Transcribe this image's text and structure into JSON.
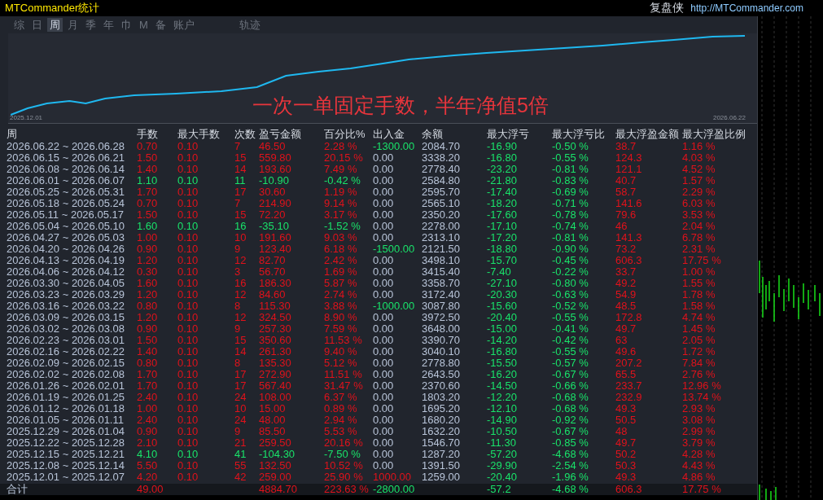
{
  "window": {
    "title": "MTCommander统计",
    "brand": "复盘侠",
    "url": "http://MTCommander.com"
  },
  "tabs": [
    {
      "label": "综",
      "selected": false
    },
    {
      "label": "日",
      "selected": false
    },
    {
      "label": "周",
      "selected": true
    },
    {
      "label": "月",
      "selected": false
    },
    {
      "label": "季",
      "selected": false
    },
    {
      "label": "年",
      "selected": false
    },
    {
      "label": "巾",
      "selected": false
    },
    {
      "label": "M",
      "selected": false
    },
    {
      "label": "备",
      "selected": false
    },
    {
      "label": "账户",
      "selected": false
    },
    {
      "label": "轨迹",
      "selected": false
    }
  ],
  "equity_chart": {
    "start_label": "2025.12.01",
    "end_label": "2026.06.22",
    "caption": "一次一单固定手数，半年净值5倍"
  },
  "table": {
    "columns": [
      "周",
      "手数",
      "最大手数",
      "次数",
      "盈亏金额",
      "百分比%",
      "出入金",
      "余额",
      "最大浮亏",
      "最大浮亏比",
      "最大浮盈金额",
      "最大浮盈比例"
    ],
    "rows": [
      {
        "loss": false,
        "withdrawal": true,
        "cells": [
          "2026.06.22 ~ 2026.06.28",
          "0.70",
          "0.10",
          "7",
          "46.50",
          "2.28 %",
          "-1300.00",
          "2084.70",
          "-16.90",
          "-0.50 %",
          "38.7",
          "1.16 %"
        ]
      },
      {
        "loss": false,
        "withdrawal": false,
        "deposit": false,
        "cells": [
          "2026.06.15 ~ 2026.06.21",
          "1.50",
          "0.10",
          "15",
          "559.80",
          "20.15 %",
          "0.00",
          "3338.20",
          "-16.80",
          "-0.55 %",
          "124.3",
          "4.03 %"
        ]
      },
      {
        "loss": false,
        "withdrawal": false,
        "deposit": false,
        "cells": [
          "2026.06.08 ~ 2026.06.14",
          "1.40",
          "0.10",
          "14",
          "193.60",
          "7.49 %",
          "0.00",
          "2778.40",
          "-23.20",
          "-0.81 %",
          "121.1",
          "4.52 %"
        ]
      },
      {
        "loss": true,
        "withdrawal": false,
        "deposit": false,
        "cells": [
          "2026.06.01 ~ 2026.06.07",
          "1.10",
          "0.10",
          "11",
          "-10.90",
          "-0.42 %",
          "0.00",
          "2584.80",
          "-21.80",
          "-0.83 %",
          "40.7",
          "1.57 %"
        ]
      },
      {
        "loss": false,
        "withdrawal": false,
        "deposit": false,
        "cells": [
          "2026.05.25 ~ 2026.05.31",
          "1.70",
          "0.10",
          "17",
          "30.60",
          "1.19 %",
          "0.00",
          "2595.70",
          "-17.40",
          "-0.69 %",
          "58.7",
          "2.29 %"
        ]
      },
      {
        "loss": false,
        "withdrawal": false,
        "deposit": false,
        "cells": [
          "2026.05.18 ~ 2026.05.24",
          "0.70",
          "0.10",
          "7",
          "214.90",
          "9.14 %",
          "0.00",
          "2565.10",
          "-18.20",
          "-0.71 %",
          "141.6",
          "6.03 %"
        ]
      },
      {
        "loss": false,
        "withdrawal": false,
        "deposit": false,
        "cells": [
          "2026.05.11 ~ 2026.05.17",
          "1.50",
          "0.10",
          "15",
          "72.20",
          "3.17 %",
          "0.00",
          "2350.20",
          "-17.60",
          "-0.78 %",
          "79.6",
          "3.53 %"
        ]
      },
      {
        "loss": true,
        "withdrawal": false,
        "deposit": false,
        "cells": [
          "2026.05.04 ~ 2026.05.10",
          "1.60",
          "0.10",
          "16",
          "-35.10",
          "-1.52 %",
          "0.00",
          "2278.00",
          "-17.10",
          "-0.74 %",
          "46",
          "2.04 %"
        ]
      },
      {
        "loss": false,
        "withdrawal": false,
        "deposit": false,
        "cells": [
          "2026.04.27 ~ 2026.05.03",
          "1.00",
          "0.10",
          "10",
          "191.60",
          "9.03 %",
          "0.00",
          "2313.10",
          "-17.20",
          "-0.81 %",
          "141.3",
          "6.78 %"
        ]
      },
      {
        "loss": false,
        "withdrawal": true,
        "cells": [
          "2026.04.20 ~ 2026.04.26",
          "0.90",
          "0.10",
          "9",
          "123.40",
          "6.18 %",
          "-1500.00",
          "2121.50",
          "-18.80",
          "-0.90 %",
          "73.2",
          "2.31 %"
        ]
      },
      {
        "loss": false,
        "withdrawal": false,
        "deposit": false,
        "cells": [
          "2026.04.13 ~ 2026.04.19",
          "1.20",
          "0.10",
          "12",
          "82.70",
          "2.42 %",
          "0.00",
          "3498.10",
          "-15.70",
          "-0.45 %",
          "606.3",
          "17.75 %"
        ]
      },
      {
        "loss": false,
        "withdrawal": false,
        "deposit": false,
        "cells": [
          "2026.04.06 ~ 2026.04.12",
          "0.30",
          "0.10",
          "3",
          "56.70",
          "1.69 %",
          "0.00",
          "3415.40",
          "-7.40",
          "-0.22 %",
          "33.7",
          "1.00 %"
        ]
      },
      {
        "loss": false,
        "withdrawal": false,
        "deposit": false,
        "cells": [
          "2026.03.30 ~ 2026.04.05",
          "1.60",
          "0.10",
          "16",
          "186.30",
          "5.87 %",
          "0.00",
          "3358.70",
          "-27.10",
          "-0.80 %",
          "49.2",
          "1.55 %"
        ]
      },
      {
        "loss": false,
        "withdrawal": false,
        "deposit": false,
        "cells": [
          "2026.03.23 ~ 2026.03.29",
          "1.20",
          "0.10",
          "12",
          "84.60",
          "2.74 %",
          "0.00",
          "3172.40",
          "-20.30",
          "-0.63 %",
          "54.9",
          "1.78 %"
        ]
      },
      {
        "loss": false,
        "withdrawal": true,
        "cells": [
          "2026.03.16 ~ 2026.03.22",
          "0.80",
          "0.10",
          "8",
          "115.30",
          "3.88 %",
          "-1000.00",
          "3087.80",
          "-15.60",
          "-0.52 %",
          "48.5",
          "1.58 %"
        ]
      },
      {
        "loss": false,
        "withdrawal": false,
        "deposit": false,
        "cells": [
          "2026.03.09 ~ 2026.03.15",
          "1.20",
          "0.10",
          "12",
          "324.50",
          "8.90 %",
          "0.00",
          "3972.50",
          "-20.40",
          "-0.55 %",
          "172.8",
          "4.74 %"
        ]
      },
      {
        "loss": false,
        "withdrawal": false,
        "deposit": false,
        "cells": [
          "2026.03.02 ~ 2026.03.08",
          "0.90",
          "0.10",
          "9",
          "257.30",
          "7.59 %",
          "0.00",
          "3648.00",
          "-15.00",
          "-0.41 %",
          "49.7",
          "1.45 %"
        ]
      },
      {
        "loss": false,
        "withdrawal": false,
        "deposit": false,
        "cells": [
          "2026.02.23 ~ 2026.03.01",
          "1.50",
          "0.10",
          "15",
          "350.60",
          "11.53 %",
          "0.00",
          "3390.70",
          "-14.20",
          "-0.42 %",
          "63",
          "2.05 %"
        ]
      },
      {
        "loss": false,
        "withdrawal": false,
        "deposit": false,
        "cells": [
          "2026.02.16 ~ 2026.02.22",
          "1.40",
          "0.10",
          "14",
          "261.30",
          "9.40 %",
          "0.00",
          "3040.10",
          "-16.80",
          "-0.55 %",
          "49.6",
          "1.72 %"
        ]
      },
      {
        "loss": false,
        "withdrawal": false,
        "deposit": false,
        "cells": [
          "2026.02.09 ~ 2026.02.15",
          "0.80",
          "0.10",
          "8",
          "135.30",
          "5.12 %",
          "0.00",
          "2778.80",
          "-15.50",
          "-0.57 %",
          "207.2",
          "7.84 %"
        ]
      },
      {
        "loss": false,
        "withdrawal": false,
        "deposit": false,
        "cells": [
          "2026.02.02 ~ 2026.02.08",
          "1.70",
          "0.10",
          "17",
          "272.90",
          "11.51 %",
          "0.00",
          "2643.50",
          "-16.20",
          "-0.67 %",
          "65.5",
          "2.76 %"
        ]
      },
      {
        "loss": false,
        "withdrawal": false,
        "deposit": false,
        "cells": [
          "2026.01.26 ~ 2026.02.01",
          "1.70",
          "0.10",
          "17",
          "567.40",
          "31.47 %",
          "0.00",
          "2370.60",
          "-14.50",
          "-0.66 %",
          "233.7",
          "12.96 %"
        ]
      },
      {
        "loss": false,
        "withdrawal": false,
        "deposit": false,
        "cells": [
          "2026.01.19 ~ 2026.01.25",
          "2.40",
          "0.10",
          "24",
          "108.00",
          "6.37 %",
          "0.00",
          "1803.20",
          "-12.20",
          "-0.68 %",
          "232.9",
          "13.74 %"
        ]
      },
      {
        "loss": false,
        "withdrawal": false,
        "deposit": false,
        "cells": [
          "2026.01.12 ~ 2026.01.18",
          "1.00",
          "0.10",
          "10",
          "15.00",
          "0.89 %",
          "0.00",
          "1695.20",
          "-12.10",
          "-0.68 %",
          "49.3",
          "2.93 %"
        ]
      },
      {
        "loss": false,
        "withdrawal": false,
        "deposit": false,
        "cells": [
          "2026.01.05 ~ 2026.01.11",
          "2.40",
          "0.10",
          "24",
          "48.00",
          "2.94 %",
          "0.00",
          "1680.20",
          "-14.90",
          "-0.92 %",
          "50.5",
          "3.08 %"
        ]
      },
      {
        "loss": false,
        "withdrawal": false,
        "deposit": false,
        "cells": [
          "2025.12.29 ~ 2026.01.04",
          "0.90",
          "0.10",
          "9",
          "85.50",
          "5.53 %",
          "0.00",
          "1632.20",
          "-10.50",
          "-0.67 %",
          "48",
          "2.99 %"
        ]
      },
      {
        "loss": false,
        "withdrawal": false,
        "deposit": false,
        "cells": [
          "2025.12.22 ~ 2025.12.28",
          "2.10",
          "0.10",
          "21",
          "259.50",
          "20.16 %",
          "0.00",
          "1546.70",
          "-11.30",
          "-0.85 %",
          "49.7",
          "3.79 %"
        ]
      },
      {
        "loss": true,
        "withdrawal": false,
        "deposit": false,
        "cells": [
          "2025.12.15 ~ 2025.12.21",
          "4.10",
          "0.10",
          "41",
          "-104.30",
          "-7.50 %",
          "0.00",
          "1287.20",
          "-57.20",
          "-4.68 %",
          "50.2",
          "4.28 %"
        ]
      },
      {
        "loss": false,
        "withdrawal": false,
        "deposit": false,
        "cells": [
          "2025.12.08 ~ 2025.12.14",
          "5.50",
          "0.10",
          "55",
          "132.50",
          "10.52 %",
          "0.00",
          "1391.50",
          "-29.90",
          "-2.54 %",
          "50.3",
          "4.43 %"
        ]
      },
      {
        "loss": false,
        "deposit": true,
        "cells": [
          "2025.12.01 ~ 2025.12.07",
          "4.20",
          "0.10",
          "42",
          "259.00",
          "25.90 %",
          "1000.00",
          "1259.00",
          "-20.40",
          "-1.96 %",
          "49.3",
          "4.86 %"
        ]
      }
    ],
    "total": {
      "loss": false,
      "withdrawal": true,
      "cells": [
        "合计",
        "49.00",
        "",
        "",
        "4884.70",
        "223.63 %",
        "-2800.00",
        "",
        "-57.2",
        "-4.68 %",
        "606.3",
        "17.75 %"
      ]
    }
  }
}
